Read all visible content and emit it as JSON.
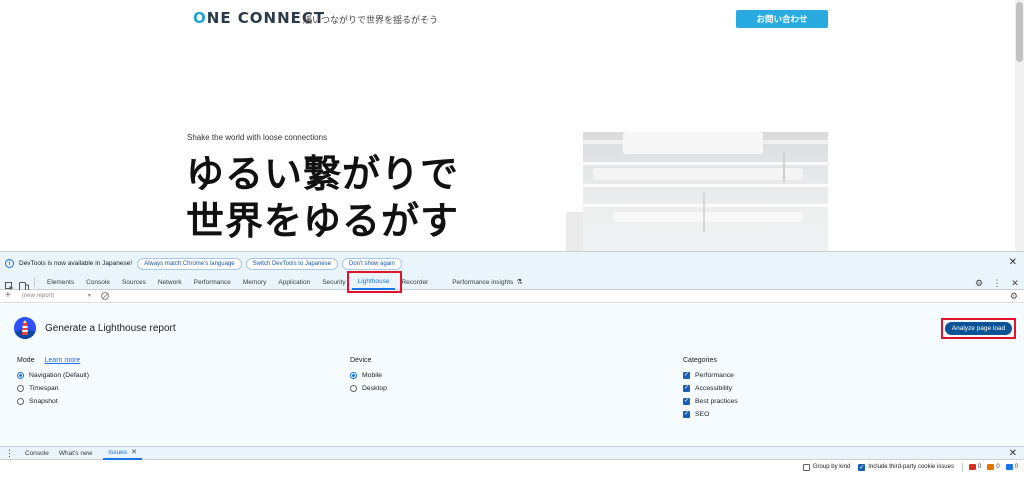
{
  "site": {
    "logo_prefix": "O",
    "logo_rest": "NE CONNECT",
    "tagline": "緩いつながりで世界を揺るがそう",
    "contact_button": "お問い合わせ",
    "hero_sub": "Shake the world with loose connections",
    "hero_line1": "ゆるい繋がりで",
    "hero_line2": "世界をゆるがす"
  },
  "devtools": {
    "notice": {
      "message": "DevTools is now available in Japanese!",
      "buttons": [
        "Always match Chrome's language",
        "Switch DevTools to Japanese",
        "Don't show again"
      ]
    },
    "tabs": [
      "Elements",
      "Console",
      "Sources",
      "Network",
      "Performance",
      "Memory",
      "Application",
      "Security",
      "Lighthouse",
      "Recorder",
      "Performance insights"
    ],
    "active_tab": "Lighthouse",
    "report_select": "(new report)",
    "lighthouse": {
      "title": "Generate a Lighthouse report",
      "analyze_button": "Analyze page load",
      "mode": {
        "heading": "Mode",
        "learn_more": "Learn more",
        "options": [
          "Navigation (Default)",
          "Timespan",
          "Snapshot"
        ],
        "selected": "Navigation (Default)"
      },
      "device": {
        "heading": "Device",
        "options": [
          "Mobile",
          "Desktop"
        ],
        "selected": "Mobile"
      },
      "categories": {
        "heading": "Categories",
        "options": [
          "Performance",
          "Accessibility",
          "Best practices",
          "SEO"
        ]
      }
    },
    "drawer": {
      "tabs": [
        "Console",
        "What's new",
        "Issues"
      ],
      "active_tab": "Issues"
    },
    "issues": {
      "group_by_kind": "Group by kind",
      "include_third_party": "Include third-party cookie issues",
      "counts": [
        "0",
        "0",
        "0"
      ]
    }
  }
}
